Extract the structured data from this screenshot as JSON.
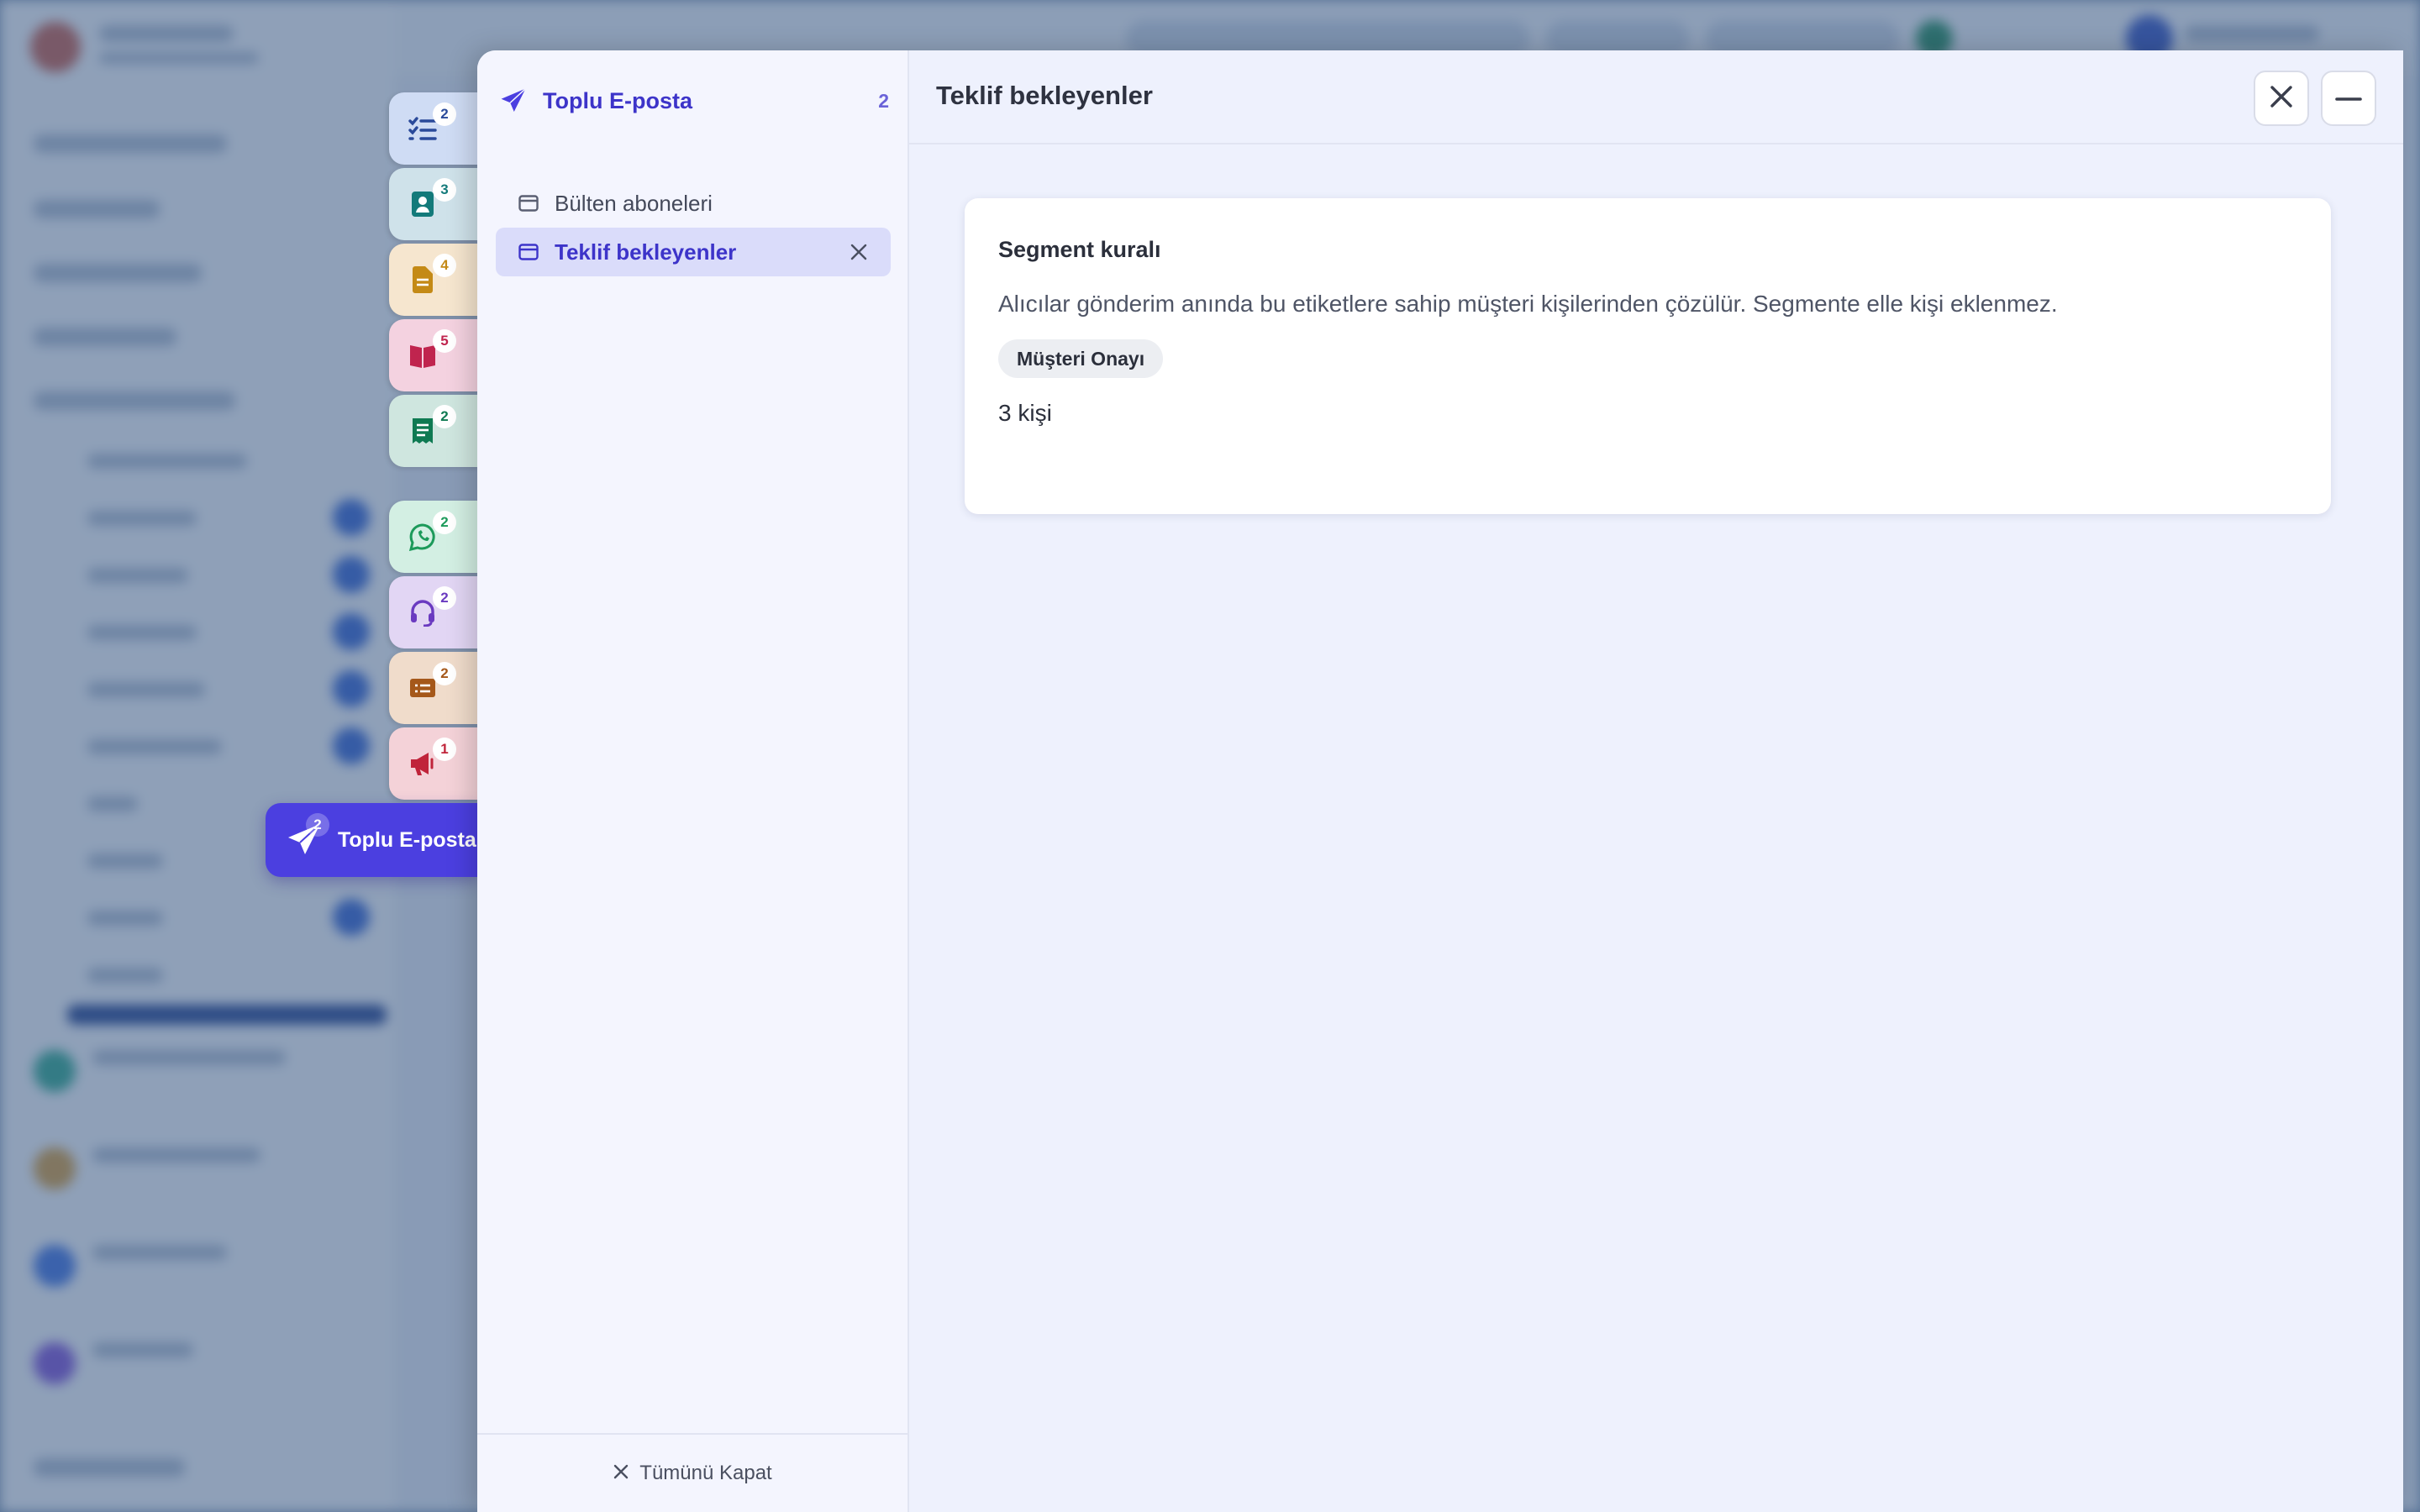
{
  "dock": {
    "tabs": [
      {
        "icon": "task-list-icon",
        "badge": "2",
        "bg": "#cfdcf4",
        "fg": "#2a4a9a"
      },
      {
        "icon": "contact-card-icon",
        "badge": "3",
        "bg": "#cfe2ea",
        "fg": "#137a7a"
      },
      {
        "icon": "document-icon",
        "badge": "4",
        "bg": "#f6e6cf",
        "fg": "#c48a16"
      },
      {
        "icon": "book-icon",
        "badge": "5",
        "bg": "#f4d2e0",
        "fg": "#c0244e"
      },
      {
        "icon": "receipt-icon",
        "badge": "2",
        "bg": "#cfe6df",
        "fg": "#0f7a52"
      },
      {
        "icon": "whatsapp-icon",
        "badge": "2",
        "bg": "#d3efe3",
        "fg": "#1c9a5a"
      },
      {
        "icon": "headset-icon",
        "badge": "2",
        "bg": "#e2d6f4",
        "fg": "#6a3ac0"
      },
      {
        "icon": "ticket-icon",
        "badge": "2",
        "bg": "#f0dccb",
        "fg": "#a5581a"
      },
      {
        "icon": "megaphone-icon",
        "badge": "1",
        "bg": "#f4d2d8",
        "fg": "#c0243a"
      }
    ],
    "active": {
      "icon": "paper-plane-icon",
      "badge": "2",
      "label": "Toplu E-posta"
    }
  },
  "sidebar": {
    "group_title": "Toplu E-posta",
    "group_count": "2",
    "segments": [
      {
        "label": "Bülten aboneleri",
        "active": false
      },
      {
        "label": "Teklif bekleyenler",
        "active": true
      }
    ],
    "close_all_label": "Tümünü Kapat"
  },
  "content": {
    "title": "Teklif bekleyenler",
    "card": {
      "title": "Segment kuralı",
      "description": "Alıcılar gönderim anında bu etiketlere sahip müşteri kişilerinden çözülür. Segmente elle kişi eklenmez.",
      "tag": "Müşteri Onayı",
      "count": "3 kişi"
    }
  },
  "colors": {
    "accent": "#4b3fe0",
    "accent_text": "#3d34c9"
  }
}
